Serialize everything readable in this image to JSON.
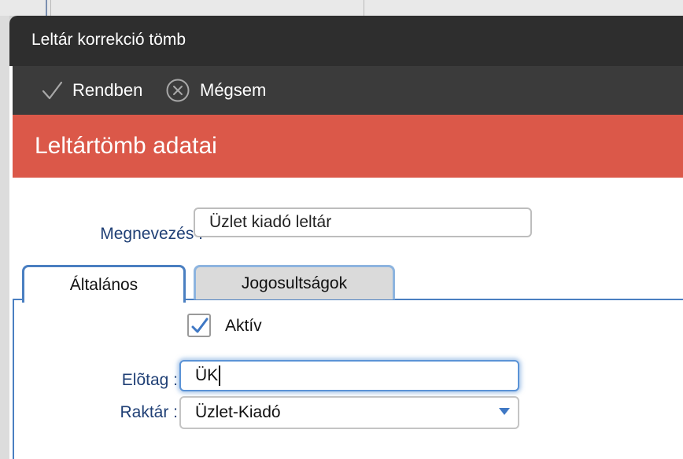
{
  "dialog": {
    "title": "Leltár korrekció tömb"
  },
  "toolbar": {
    "ok_label": "Rendben",
    "cancel_label": "Mégsem",
    "ok_icon": "checkmark-icon",
    "cancel_icon": "close-circle-icon"
  },
  "section": {
    "title": "Leltártömb adatai",
    "color": "#db5849"
  },
  "form": {
    "name_label": "Megnevezés :",
    "name_value": "Üzlet kiadó leltár"
  },
  "tabs": [
    {
      "label": "Általános",
      "active": true
    },
    {
      "label": "Jogosultságok",
      "active": false
    }
  ],
  "general": {
    "active_label": "Aktív",
    "active_checked": true,
    "prefix_label": "Elõtag :",
    "prefix_value": "ÜK",
    "warehouse_label": "Raktár :",
    "warehouse_value": "Üzlet-Kiadó"
  },
  "colors": {
    "accent": "#4a7fc1",
    "label_text": "#1f3f75",
    "titlebar": "#2e2e2e",
    "toolbar": "#3b3b3b"
  }
}
